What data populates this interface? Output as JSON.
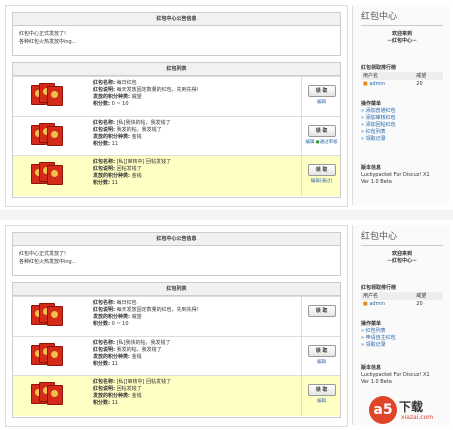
{
  "colors": {
    "highlight": "#ffffc4",
    "accent": "#2266aa",
    "envelope": "#d42a1a"
  },
  "notice": {
    "title": "红包中心公告信息",
    "lines": [
      "红包中心正式发放了!",
      "各种红包火热发放中ing..."
    ]
  },
  "list_title": "红包列表",
  "packets": [
    {
      "name_label": "红包名称:",
      "name": "每日红包",
      "desc_label": "红包说明:",
      "desc": "每天发放固定数量的红包，先到先得!",
      "sender_label": "发放的积分种类:",
      "sender": "威望",
      "points_label": "积分数:",
      "points": "0 ~ 10",
      "button": "领 取",
      "links": [
        "编辑"
      ]
    },
    {
      "name_label": "红包名称:",
      "name": "[私]我快的帖，我发钱了",
      "desc_label": "红包说明:",
      "desc": "我发的帖，我发钱了",
      "sender_label": "发放的积分种类:",
      "sender": "金钱",
      "points_label": "积分数:",
      "points": "11",
      "button": "领 取",
      "links": [
        "编辑",
        "通过审核"
      ]
    },
    {
      "name_label": "红包名称:",
      "name": "[私][审核中] 回帖发钱了",
      "desc_label": "红包说明:",
      "desc": "回帖发钱了",
      "sender_label": "发放的积分种类:",
      "sender": "金钱",
      "points_label": "积分数:",
      "points": "11",
      "button": "领 取",
      "links": [
        "编辑[通过]"
      ]
    }
  ],
  "packets2": [
    {
      "name_label": "红包名称:",
      "name": "每日红包",
      "desc_label": "红包说明:",
      "desc": "每天发放固定数量的红包，先到先得!",
      "sender_label": "发放的积分种类:",
      "sender": "威望",
      "points_label": "积分数:",
      "points": "0 ~ 10",
      "button": "领 取",
      "links": []
    },
    {
      "name_label": "红包名称:",
      "name": "[私]我快的帖，我发钱了",
      "desc_label": "红包说明:",
      "desc": "我发的帖，我发钱了",
      "sender_label": "发放的积分种类:",
      "sender": "金钱",
      "points_label": "积分数:",
      "points": "11",
      "button": "领 取",
      "links": [
        "编辑"
      ]
    },
    {
      "name_label": "红包名称:",
      "name": "[私][审核中] 回帖发钱了",
      "desc_label": "红包说明:",
      "desc": "回帖发钱了",
      "sender_label": "发放的积分种类:",
      "sender": "金钱",
      "points_label": "积分数:",
      "points": "11",
      "button": "领 取",
      "links": [
        "编辑"
      ]
    }
  ],
  "sidebar": {
    "title": "红包中心",
    "welcome1": "欢迎来到",
    "welcome2": "－红包中心－",
    "rank_title": "红包领取排行榜",
    "rank_headers": [
      "用户名",
      "威望"
    ],
    "rank_user": "admin",
    "rank_value": "20",
    "menu_title": "操作菜单",
    "menu": [
      "添加普通红包",
      "添加审核红包",
      "添加回帖红包",
      "红包列表",
      "领取记录"
    ],
    "menu2": [
      "红包列表",
      "申请自主红包",
      "领取记录"
    ],
    "version_title": "版本信息",
    "version_line1": "Luckypacket For Discuz! X1",
    "version_line2": "Ver 1.0 Beta"
  },
  "watermark": {
    "logo": "a5",
    "text": "下载",
    "url": "xiazai.com"
  }
}
